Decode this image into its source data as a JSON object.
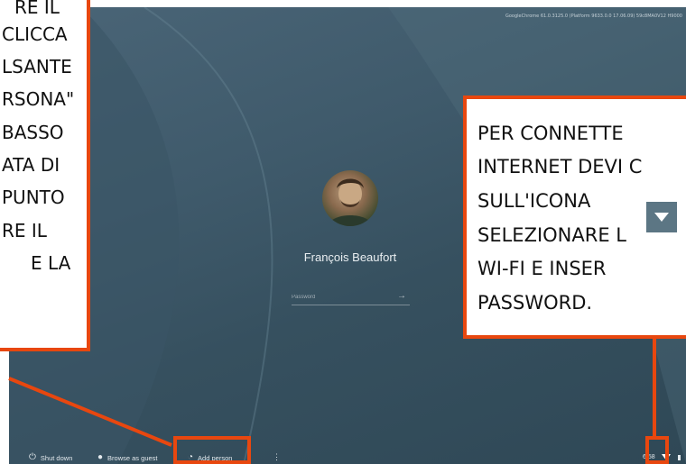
{
  "login": {
    "version_info": "GoogleChrome 61.0.3125.0 (Platform 9633.0.0 17.06.09) 59c8MA0V12 H9000",
    "user_name": "François Beaufort",
    "password_placeholder": "Password",
    "submit_icon": "arrow-right-icon"
  },
  "shelf": {
    "shut_down": "Shut down",
    "browse_as_guest": "Browse as guest",
    "add_person": "Add person",
    "more_icon": "more-vert-icon",
    "time": "6:58",
    "locale": "US"
  },
  "annotations": {
    "left_lines": [
      "RE IL",
      "CLICCA",
      "LSANTE",
      "RSONA\"",
      "BASSO",
      "ATA DI",
      "PUNTO",
      "RE IL",
      "E LA"
    ],
    "right_lines": [
      "PER CONNETTE",
      "INTERNET DEVI C",
      "SULL'ICONA",
      "SELEZIONARE L",
      "WI-FI E INSER",
      "PASSWORD."
    ],
    "highlight_color": "#e8470f"
  }
}
